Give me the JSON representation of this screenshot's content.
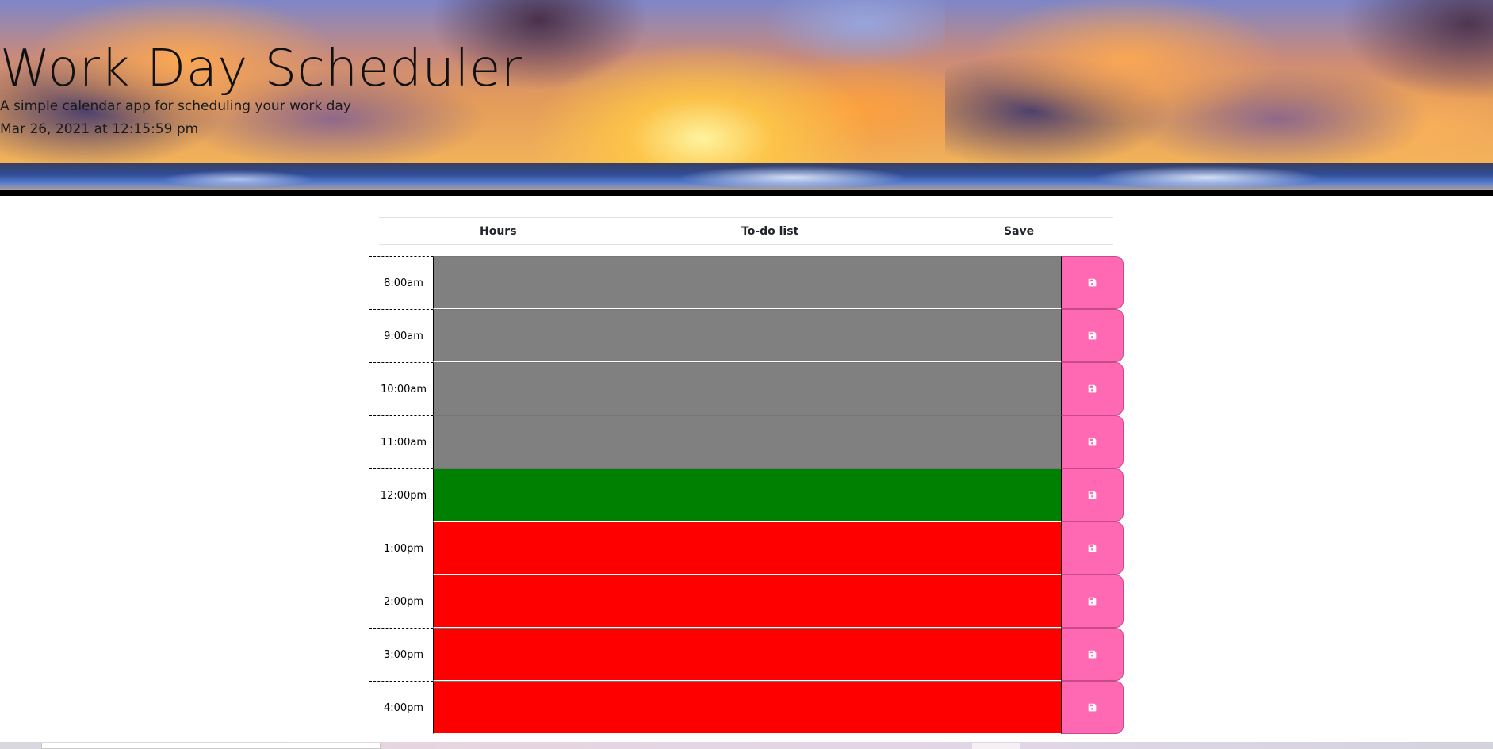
{
  "header": {
    "title": "Work Day Scheduler",
    "subtitle": "A simple calendar app for scheduling your work day",
    "datetime": "Mar 26, 2021 at 12:15:59 pm"
  },
  "table": {
    "columns": [
      "Hours",
      "To-do list",
      "Save"
    ]
  },
  "rows": [
    {
      "hour": "8:00am",
      "state": "past",
      "todo": ""
    },
    {
      "hour": "9:00am",
      "state": "past",
      "todo": ""
    },
    {
      "hour": "10:00am",
      "state": "past",
      "todo": ""
    },
    {
      "hour": "11:00am",
      "state": "past",
      "todo": ""
    },
    {
      "hour": "12:00pm",
      "state": "present",
      "todo": ""
    },
    {
      "hour": "1:00pm",
      "state": "future",
      "todo": ""
    },
    {
      "hour": "2:00pm",
      "state": "future",
      "todo": ""
    },
    {
      "hour": "3:00pm",
      "state": "future",
      "todo": ""
    },
    {
      "hour": "4:00pm",
      "state": "future",
      "todo": ""
    }
  ],
  "colors": {
    "past": "#808080",
    "present": "#008000",
    "future": "#ff0000",
    "save_button": "#ff69b4"
  },
  "icons": {
    "save": "floppy-disk-icon"
  }
}
